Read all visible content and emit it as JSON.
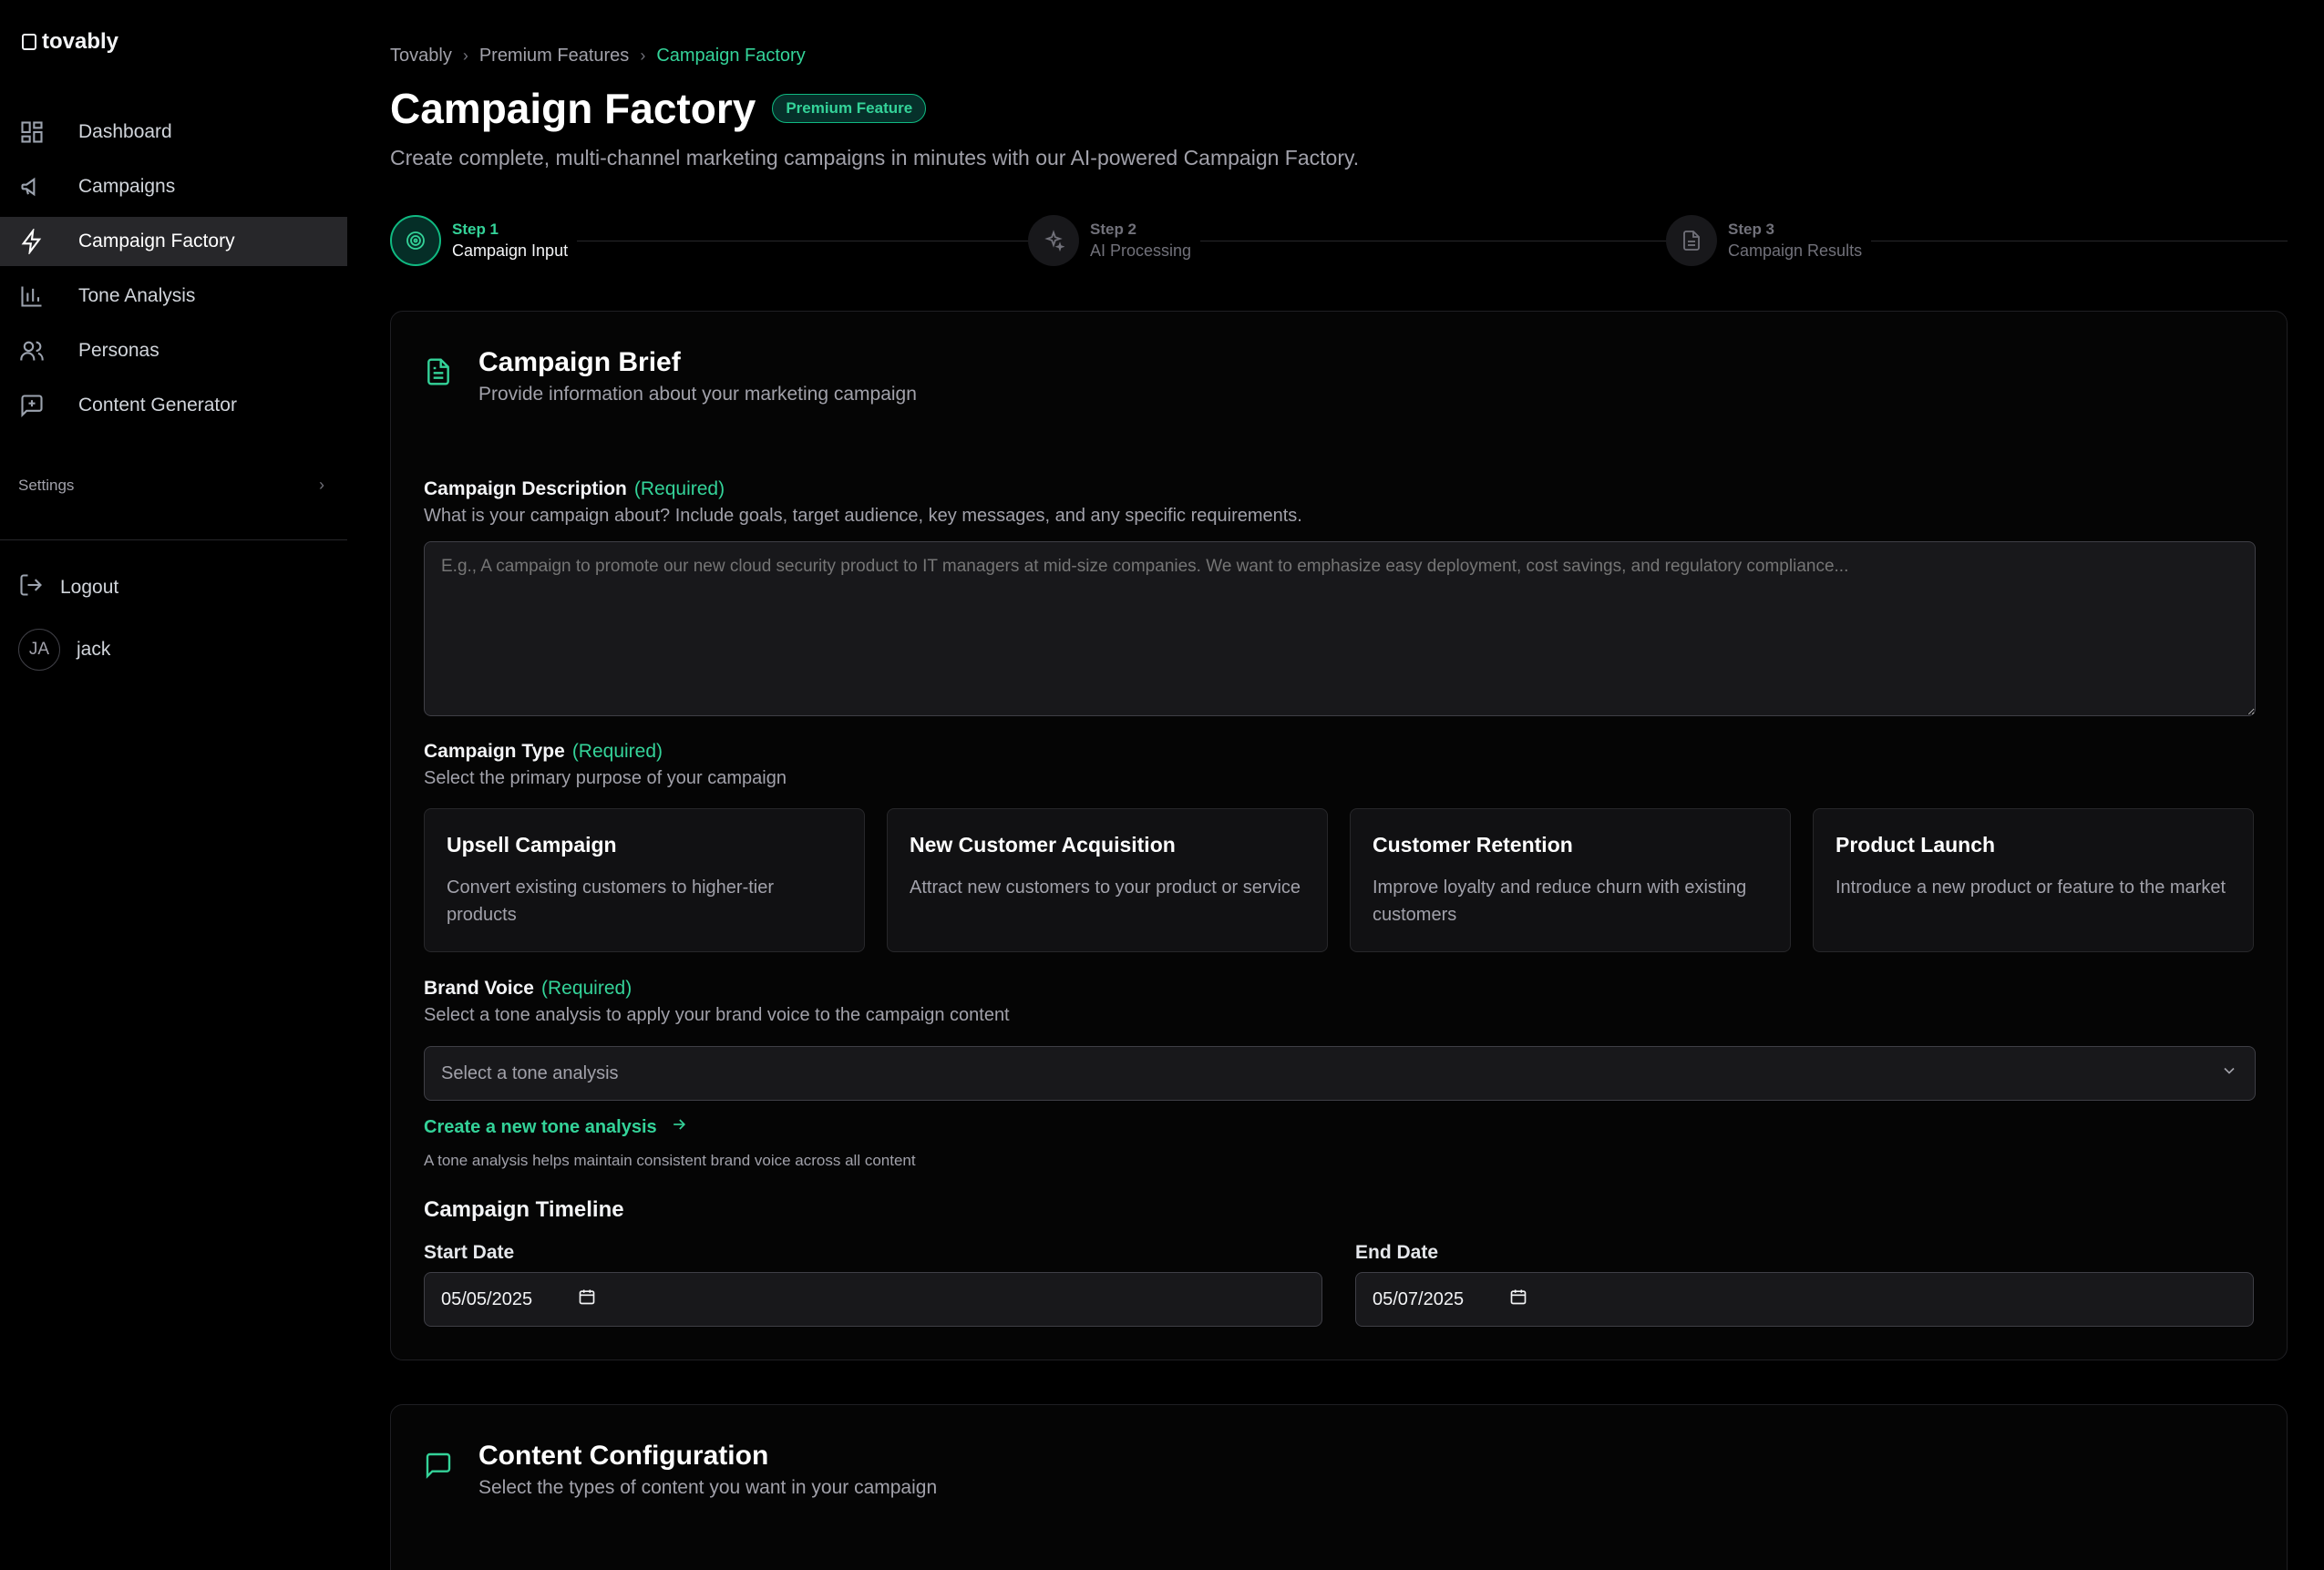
{
  "app": {
    "logo_text": "tovably"
  },
  "sidebar": {
    "items": [
      {
        "label": "Dashboard",
        "icon": "grid-icon"
      },
      {
        "label": "Campaigns",
        "icon": "megaphone-icon"
      },
      {
        "label": "Campaign Factory",
        "icon": "bolt-icon",
        "active": true
      },
      {
        "label": "Tone Analysis",
        "icon": "bar-chart-icon"
      },
      {
        "label": "Personas",
        "icon": "users-icon"
      },
      {
        "label": "Content Generator",
        "icon": "message-plus-icon"
      }
    ],
    "settings_label": "Settings",
    "logout_label": "Logout",
    "user": {
      "initials": "JA",
      "name": "jack"
    }
  },
  "breadcrumb": [
    "Tovably",
    "Premium Features",
    "Campaign Factory"
  ],
  "header": {
    "title": "Campaign Factory",
    "badge": "Premium Feature",
    "subtitle": "Create complete, multi-channel marketing campaigns in minutes with our AI-powered Campaign Factory."
  },
  "steps": [
    {
      "label": "Step 1",
      "name": "Campaign Input",
      "active": true
    },
    {
      "label": "Step 2",
      "name": "AI Processing",
      "active": false
    },
    {
      "label": "Step 3",
      "name": "Campaign Results",
      "active": false
    }
  ],
  "brief": {
    "title": "Campaign Brief",
    "desc": "Provide information about your marketing campaign",
    "description_label": "Campaign Description",
    "required": "(Required)",
    "description_help": "What is your campaign about? Include goals, target audience, key messages, and any specific requirements.",
    "description_placeholder": "E.g., A campaign to promote our new cloud security product to IT managers at mid-size companies. We want to emphasize easy deployment, cost savings, and regulatory compliance...",
    "type_label": "Campaign Type",
    "type_help": "Select the primary purpose of your campaign",
    "types": [
      {
        "title": "Upsell Campaign",
        "desc": "Convert existing customers to higher-tier products"
      },
      {
        "title": "New Customer Acquisition",
        "desc": "Attract new customers to your product or service"
      },
      {
        "title": "Customer Retention",
        "desc": "Improve loyalty and reduce churn with existing customers"
      },
      {
        "title": "Product Launch",
        "desc": "Introduce a new product or feature to the market"
      }
    ],
    "voice_label": "Brand Voice",
    "voice_help": "Select a tone analysis to apply your brand voice to the campaign content",
    "voice_placeholder": "Select a tone analysis",
    "voice_link": "Create a new tone analysis",
    "voice_note": "A tone analysis helps maintain consistent brand voice across all content",
    "timeline_title": "Campaign Timeline",
    "start_label": "Start Date",
    "start_value": "05/05/2025",
    "end_label": "End Date",
    "end_value": "05/07/2025"
  },
  "content_config": {
    "title": "Content Configuration",
    "desc": "Select the types of content you want in your campaign"
  },
  "colors": {
    "accent": "#34d399",
    "bg": "#000000",
    "active_nav": "#27272a"
  }
}
